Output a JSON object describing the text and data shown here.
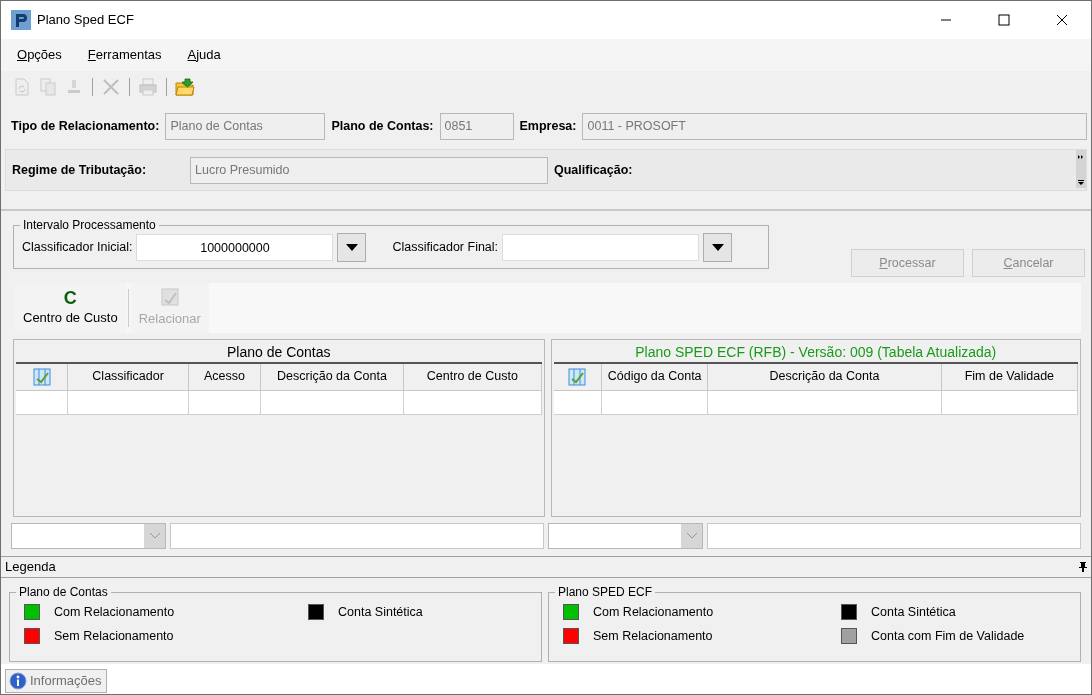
{
  "window": {
    "title": "Plano Sped ECF"
  },
  "menu": [
    {
      "label": "Opções"
    },
    {
      "label": "Ferramentas"
    },
    {
      "label": "Ajuda"
    }
  ],
  "toolbar": [
    {
      "kind": "button",
      "disabled": true
    },
    {
      "kind": "button",
      "disabled": true
    },
    {
      "kind": "button",
      "disabled": true
    },
    {
      "kind": "separator"
    },
    {
      "kind": "button",
      "disabled": true
    },
    {
      "kind": "separator"
    },
    {
      "kind": "button",
      "disabled": true
    },
    {
      "kind": "separator"
    },
    {
      "kind": "button",
      "disabled": false
    }
  ],
  "header": {
    "rows": [
      [
        {
          "label": "Tipo de Relacionamento:",
          "value": "Plano de Contas"
        },
        {
          "label": "Plano de Contas:",
          "value": "0851"
        },
        {
          "label": "Empresa:",
          "value": "0011 - PROSOFT"
        }
      ],
      [
        {
          "label": "Regime de Tributação:",
          "value": "Lucro Presumido"
        },
        "",
        {
          "label": "Qualificação:"
        }
      ]
    ]
  },
  "interval": {
    "title": "Intervalo Processamento",
    "fields": [
      {
        "label": "Classificador Inicial:",
        "value": "1000000000"
      },
      {
        "label": "Classificador Final:"
      }
    ]
  },
  "actions": [
    {
      "label": "Processar",
      "disabled": true
    },
    {
      "label": "Cancelar",
      "disabled": true
    }
  ],
  "ribbon": [
    {
      "label": "Centro de Custo",
      "icon": "C",
      "disabled": false
    },
    {
      "label": "Relacionar",
      "disabled": true
    }
  ],
  "grids": [
    {
      "title": "Plano de Contas",
      "color": "#000000",
      "columns": [
        {
          "kind": "icon"
        },
        {
          "kind": "text",
          "label": "Classificador"
        },
        {
          "kind": "text",
          "label": "Acesso"
        },
        {
          "kind": "text",
          "label": "Descrição da Conta"
        },
        {
          "kind": "text",
          "label": "Centro de Custo"
        }
      ]
    },
    {
      "title": "Plano SPED ECF (RFB) - Versão: 009 (Tabela Atualizada)",
      "color": "#1a9a1a",
      "columns": [
        {
          "kind": "icon"
        },
        {
          "kind": "text",
          "label": "Código da Conta"
        },
        {
          "kind": "text",
          "label": "Descrição da Conta"
        },
        {
          "kind": "text",
          "label": "Fim de Validade"
        }
      ]
    }
  ],
  "legend": {
    "title": "Legenda",
    "groups": [
      {
        "title": "Plano de Contas",
        "items": [
          {
            "label": "Com Relacionamento",
            "color": "#00c000"
          },
          {
            "label": "Sem Relacionamento",
            "color": "#ff0000"
          },
          {
            "label": "Conta Sintética",
            "color": "#000000"
          }
        ]
      },
      {
        "title": "Plano SPED ECF",
        "items": [
          {
            "label": "Com Relacionamento",
            "color": "#00c000"
          },
          {
            "label": "Sem Relacionamento",
            "color": "#ff0000"
          },
          {
            "label": "Conta Sintética",
            "color": "#000000"
          },
          {
            "label": "Conta com Fim de Validade",
            "color": "#a0a0a0"
          }
        ]
      }
    ]
  },
  "bottom_tabs": [
    {
      "label": "Informações",
      "selected": true
    }
  ]
}
